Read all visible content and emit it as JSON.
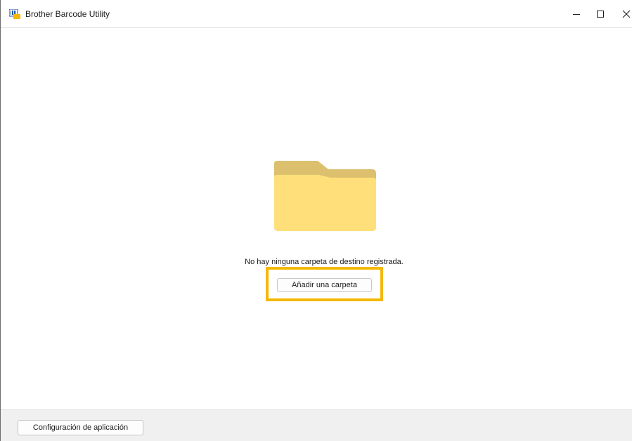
{
  "window": {
    "title": "Brother Barcode Utility",
    "controls": {
      "minimize_icon": "minimize-icon",
      "maximize_icon": "maximize-icon",
      "close_icon": "close-icon"
    }
  },
  "main": {
    "empty_state": {
      "icon": "folder-icon",
      "message": "No hay ninguna carpeta de destino registrada.",
      "add_button_label": "Añadir una carpeta"
    }
  },
  "footer": {
    "settings_button_label": "Configuración de aplicación"
  },
  "colors": {
    "highlight": "#f5b800",
    "folder_front": "#fedf7a",
    "folder_back": "#dcc06e",
    "footer_bg": "#f0f0f0"
  }
}
